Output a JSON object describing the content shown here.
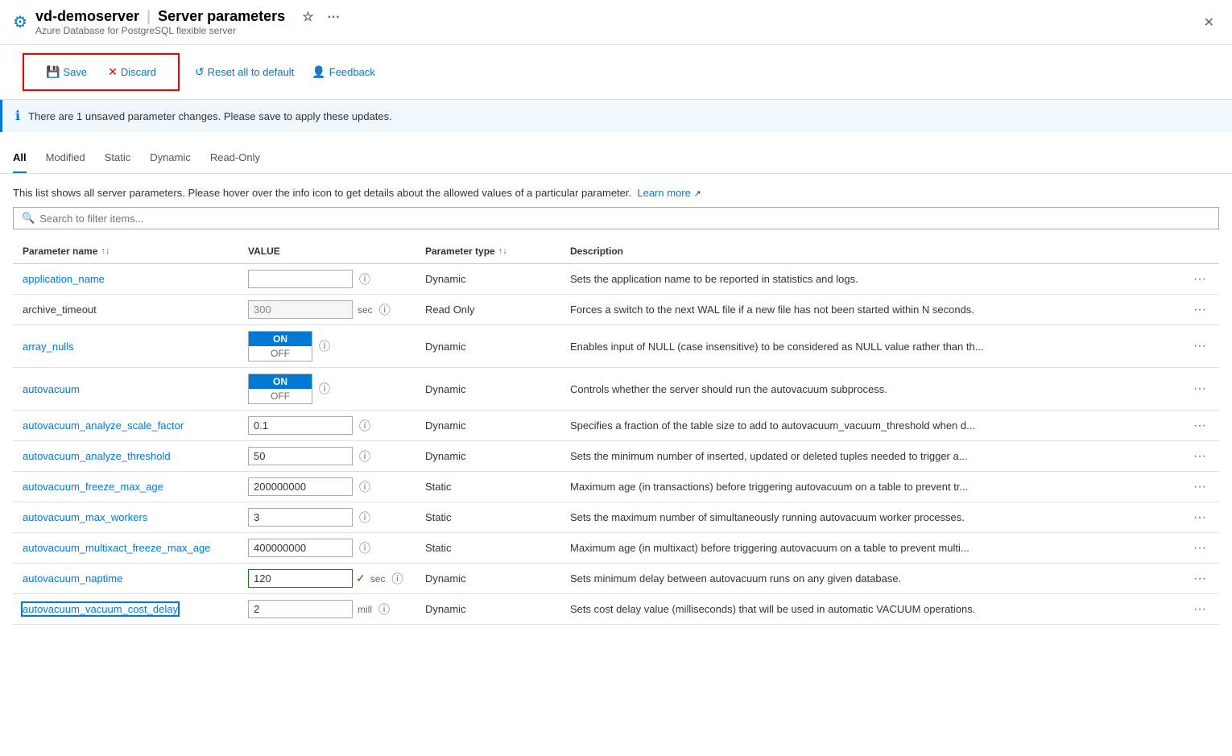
{
  "titleBar": {
    "serverName": "vd-demoserver",
    "separator": "|",
    "pageTitle": "Server parameters",
    "subtitle": "Azure Database for PostgreSQL flexible server"
  },
  "toolbar": {
    "saveLabel": "Save",
    "discardLabel": "Discard",
    "resetLabel": "Reset all to default",
    "feedbackLabel": "Feedback"
  },
  "infoBanner": {
    "message": "There are 1 unsaved parameter changes.  Please save to apply these updates."
  },
  "tabs": [
    {
      "id": "all",
      "label": "All",
      "active": true
    },
    {
      "id": "modified",
      "label": "Modified",
      "active": false
    },
    {
      "id": "static",
      "label": "Static",
      "active": false
    },
    {
      "id": "dynamic",
      "label": "Dynamic",
      "active": false
    },
    {
      "id": "readonly",
      "label": "Read-Only",
      "active": false
    }
  ],
  "description": {
    "text": "This list shows all server parameters. Please hover over the info icon to get details about the allowed values of a particular parameter.",
    "learnMoreLabel": "Learn more"
  },
  "search": {
    "placeholder": "Search to filter items..."
  },
  "tableHeaders": {
    "paramName": "Parameter name",
    "value": "VALUE",
    "paramType": "Parameter type",
    "description": "Description"
  },
  "rows": [
    {
      "name": "application_name",
      "isLink": true,
      "selected": false,
      "valueType": "text",
      "value": "",
      "unit": "",
      "readonly": false,
      "modified": false,
      "hasCheck": false,
      "paramType": "Dynamic",
      "description": "Sets the application name to be reported in statistics and logs."
    },
    {
      "name": "archive_timeout",
      "isLink": false,
      "selected": false,
      "valueType": "text",
      "value": "300",
      "unit": "sec",
      "readonly": true,
      "modified": false,
      "hasCheck": false,
      "paramType": "Read Only",
      "description": "Forces a switch to the next WAL file if a new file has not been started within N seconds."
    },
    {
      "name": "array_nulls",
      "isLink": true,
      "selected": false,
      "valueType": "toggle",
      "toggleOn": true,
      "unit": "",
      "readonly": false,
      "modified": false,
      "hasCheck": false,
      "paramType": "Dynamic",
      "description": "Enables input of NULL (case insensitive) to be considered as NULL value rather than th..."
    },
    {
      "name": "autovacuum",
      "isLink": true,
      "selected": false,
      "valueType": "toggle",
      "toggleOn": true,
      "unit": "",
      "readonly": false,
      "modified": false,
      "hasCheck": false,
      "paramType": "Dynamic",
      "description": "Controls whether the server should run the autovacuum subprocess."
    },
    {
      "name": "autovacuum_analyze_scale_factor",
      "isLink": true,
      "selected": false,
      "valueType": "text",
      "value": "0.1",
      "unit": "",
      "readonly": false,
      "modified": false,
      "hasCheck": false,
      "paramType": "Dynamic",
      "description": "Specifies a fraction of the table size to add to autovacuum_vacuum_threshold when d..."
    },
    {
      "name": "autovacuum_analyze_threshold",
      "isLink": true,
      "selected": false,
      "valueType": "text",
      "value": "50",
      "unit": "",
      "readonly": false,
      "modified": false,
      "hasCheck": false,
      "paramType": "Dynamic",
      "description": "Sets the minimum number of inserted, updated or deleted tuples needed to trigger a..."
    },
    {
      "name": "autovacuum_freeze_max_age",
      "isLink": true,
      "selected": false,
      "valueType": "text",
      "value": "200000000",
      "unit": "",
      "readonly": false,
      "modified": false,
      "hasCheck": false,
      "paramType": "Static",
      "description": "Maximum age (in transactions) before triggering autovacuum on a table to prevent tr..."
    },
    {
      "name": "autovacuum_max_workers",
      "isLink": true,
      "selected": false,
      "valueType": "text",
      "value": "3",
      "unit": "",
      "readonly": false,
      "modified": false,
      "hasCheck": false,
      "paramType": "Static",
      "description": "Sets the maximum number of simultaneously running autovacuum worker processes."
    },
    {
      "name": "autovacuum_multixact_freeze_max_age",
      "isLink": true,
      "selected": false,
      "valueType": "text",
      "value": "400000000",
      "unit": "",
      "readonly": false,
      "modified": false,
      "hasCheck": false,
      "paramType": "Static",
      "description": "Maximum age (in multixact) before triggering autovacuum on a table to prevent multi..."
    },
    {
      "name": "autovacuum_naptime",
      "isLink": true,
      "selected": false,
      "valueType": "text",
      "value": "120",
      "unit": "sec",
      "readonly": false,
      "modified": true,
      "hasCheck": true,
      "paramType": "Dynamic",
      "description": "Sets minimum delay between autovacuum runs on any given database."
    },
    {
      "name": "autovacuum_vacuum_cost_delay",
      "isLink": true,
      "selected": true,
      "valueType": "text",
      "value": "2",
      "unit": "mill",
      "readonly": false,
      "modified": false,
      "hasCheck": false,
      "paramType": "Dynamic",
      "description": "Sets cost delay value (milliseconds) that will be used in automatic VACUUM operations."
    }
  ]
}
